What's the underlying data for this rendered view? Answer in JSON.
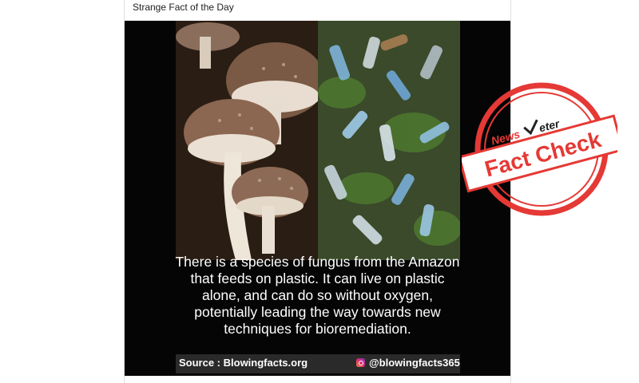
{
  "post": {
    "caption": "Strange Fact of the Day"
  },
  "image": {
    "fact_lines": [
      "There is a species of fungus from the Amazon",
      "that feeds on plastic. It can live on plastic",
      "alone, and can do so without oxygen,",
      "potentially leading the way towards new",
      "techniques for bioremediation."
    ],
    "source": "Source : Blowingfacts.org",
    "instagram_handle": "@blowingfacts365"
  },
  "stamp": {
    "brand_left": "News",
    "brand_right": "eter",
    "label": "Fact Check",
    "color": "#e53935"
  }
}
